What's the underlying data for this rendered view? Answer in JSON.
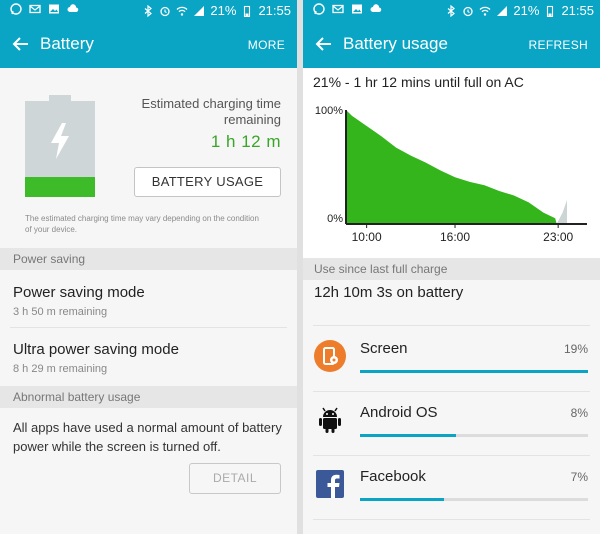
{
  "status": {
    "battery_pct": "21%",
    "time": "21:55"
  },
  "left": {
    "title": "Battery",
    "action": "MORE",
    "battery_level": 0.21,
    "est_label": "Estimated charging time remaining",
    "est_value": "1 h 12 m",
    "usage_button": "BATTERY USAGE",
    "charge_note": "The estimated charging time may vary depending on the condition of your device.",
    "power_saving_header": "Power saving",
    "power_saving_title": "Power saving mode",
    "power_saving_sub": "3 h 50 m remaining",
    "ultra_title": "Ultra power saving mode",
    "ultra_sub": "8 h 29 m remaining",
    "abnormal_header": "Abnormal battery usage",
    "abnormal_text": "All apps have used a normal amount of battery power while the screen is turned off.",
    "detail_button": "DETAIL"
  },
  "right": {
    "title": "Battery usage",
    "action": "REFRESH",
    "graph_title": "21% - 1 hr 12 mins until full on AC",
    "since_header": "Use since last full charge",
    "on_battery": "12h 10m 3s on battery",
    "apps": [
      {
        "name": "Screen",
        "pct": "19%",
        "fraction": 0.19
      },
      {
        "name": "Android OS",
        "pct": "8%",
        "fraction": 0.08
      },
      {
        "name": "Facebook",
        "pct": "7%",
        "fraction": 0.07
      }
    ]
  },
  "chart_data": {
    "type": "area",
    "title": "21% - 1 hr 12 mins until full on AC",
    "ytick_labels": [
      "100%",
      "0%"
    ],
    "xtick_labels": [
      "10:00",
      "16:00",
      "23:00"
    ],
    "ylim": [
      0,
      100
    ],
    "x_hours": [
      8.6,
      9.0,
      10.0,
      11.0,
      12.0,
      13.0,
      14.0,
      15.0,
      16.0,
      17.0,
      18.0,
      19.0,
      20.0,
      21.0,
      22.0,
      22.8,
      22.9,
      23.3,
      23.6
    ],
    "y_pct": [
      100,
      95,
      86,
      77,
      67,
      60,
      54,
      47,
      41,
      37,
      34,
      29,
      25,
      19,
      10,
      5,
      0,
      10,
      21
    ],
    "grid": false,
    "colors": {
      "discharge": "#35b51c",
      "charging": "#cdd4d4",
      "accent": "#0aa5c4"
    }
  }
}
